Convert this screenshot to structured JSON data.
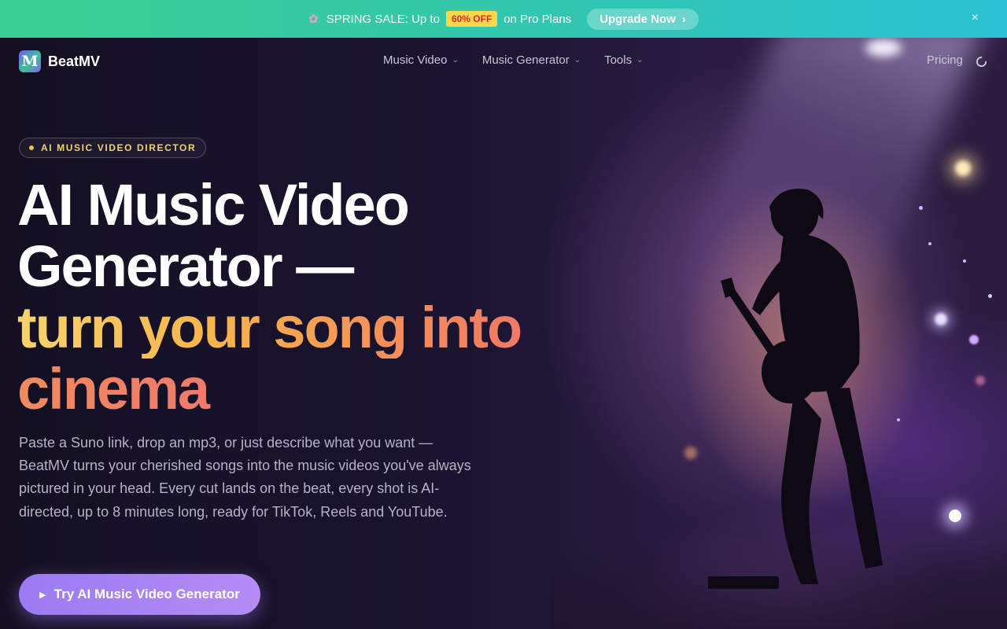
{
  "promo": {
    "flower_icon": "flower-icon",
    "text_before": "SPRING SALE: Up to",
    "badge": "60% OFF",
    "text_after": "on Pro Plans",
    "upgrade_label": "Upgrade Now",
    "upgrade_chevron": "›",
    "close_glyph": "×",
    "bg_start": "#3ccf93",
    "bg_end": "#2cc1d3"
  },
  "nav": {
    "logo_letter": "M",
    "brand": "BeatMV",
    "menu": [
      {
        "label": "Music Video",
        "chevron": "⌄"
      },
      {
        "label": "Music Generator",
        "chevron": "⌄"
      },
      {
        "label": "Tools",
        "chevron": "⌄"
      }
    ],
    "pricing": "Pricing",
    "loading_icon": "spinner-icon"
  },
  "hero": {
    "eyebrow": "AI MUSIC VIDEO DIRECTOR",
    "headline_line1": "AI Music Video",
    "headline_line2": "Generator —",
    "headline_line3": "turn your song into",
    "headline_line4": "cinema",
    "description": "Paste a Suno link, drop an mp3, or just describe what you want — BeatMV turns your cherished songs into the music videos you've always pictured in your head. Every cut lands on the beat, every shot is AI-directed, up to 8 minutes long, ready for TikTok, Reels and YouTube.",
    "cta_label": "Try AI Music Video Generator",
    "cta_icon": "play-icon",
    "accent_gold": "#f7d36c",
    "accent_coral": "#ee6f6a",
    "cta_color": "#a982f3"
  }
}
